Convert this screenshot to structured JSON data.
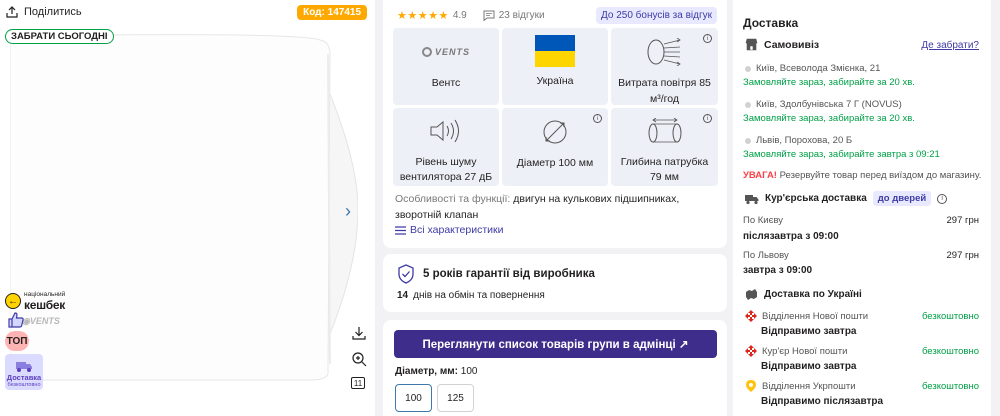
{
  "gallery": {
    "share_label": "Поділитись",
    "code_badge": "Код: 147415",
    "pickup_badge": "ЗАБРАТИ СЬОГОДНІ",
    "cashback_small": "національний",
    "cashback_big": "кешбек",
    "top_badge": "ТОП",
    "delivery_free_l1": "Доставка",
    "delivery_free_l2": "безкоштовно",
    "image_count": "11"
  },
  "rating": {
    "stars_filled": 5,
    "value": "4.9",
    "reviews": "23 відгуки",
    "bonus": "До 250 бонусів за відгук"
  },
  "features": [
    {
      "text": "Вентс",
      "icon": "vents-logo",
      "logo_text": "VENTS"
    },
    {
      "text": "Україна",
      "icon": "ukraine-flag"
    },
    {
      "text": "Витрата повітря 85 м³/год",
      "icon": "airflow-icon",
      "info": true
    },
    {
      "text": "Рівень шуму вентилятора 27 дБ",
      "icon": "noise-icon"
    },
    {
      "text": "Діаметр 100 мм",
      "icon": "diameter-icon",
      "info": true
    },
    {
      "text": "Глибина патрубка 79 мм",
      "icon": "pipe-icon",
      "info": true
    }
  ],
  "features_text": {
    "label": "Особливості та функції:",
    "value": "двигун на кулькових підшипниках, зворотній клапан"
  },
  "all_chars": "Всі характеристики",
  "warranty": {
    "title": "5 років гарантії від виробника",
    "days_num": "14",
    "days_text": "днів на обмін та повернення"
  },
  "admin": {
    "button": "Переглянути список товарів групи в адмінці ↗",
    "diam_label": "Діаметр, мм:",
    "diam_value": "100",
    "sizes": [
      "100",
      "125"
    ],
    "selected": "100"
  },
  "delivery": {
    "title": "Доставка",
    "self_pick": "Самовивіз",
    "pick_link": "Де забрати?",
    "stores": [
      {
        "addr": "Київ, Всеволода Змієнка, 21",
        "order": "Замовляйте зараз, забирайте за 20 хв."
      },
      {
        "addr": "Київ, Здолбунівська 7 Г (NOVUS)",
        "order": "Замовляйте зараз, забирайте за 20 хв."
      },
      {
        "addr": "Львів, Порохова, 20 Б",
        "order": "Замовляйте зараз, забирайте завтра з 09:21"
      }
    ],
    "warning_bold": "УВАГА!",
    "warning_text": "Резервуйте товар перед виїздом до магазину.",
    "courier": "Кур'єрська доставка",
    "door_badge": "до дверей",
    "kyiv_label": "По Києву",
    "kyiv_price": "297 грн",
    "kyiv_when": "післязавтра з 09:00",
    "lviv_label": "По Львову",
    "lviv_price": "297 грн",
    "lviv_when": "завтра з 09:00",
    "ukraine": "Доставка по Україні",
    "carriers": [
      {
        "name": "Відділення Нової пошти",
        "price": "безкоштовно",
        "ship": "Відправимо завтра",
        "icon": "nova-poshta-icon"
      },
      {
        "name": "Кур'єр Нової пошти",
        "price": "безкоштовно",
        "ship": "Відправимо завтра",
        "icon": "nova-poshta-icon"
      },
      {
        "name": "Відділення Укрпошти",
        "price": "безкоштовно",
        "ship": "Відправимо післязавтра",
        "icon": "ukrposhta-icon"
      }
    ]
  },
  "colors": {
    "accent": "#3e77aa",
    "green": "#00a046",
    "admin_btn": "#3e2d8a",
    "star": "#ffa900",
    "badge_bg": "#e8e9ff"
  }
}
